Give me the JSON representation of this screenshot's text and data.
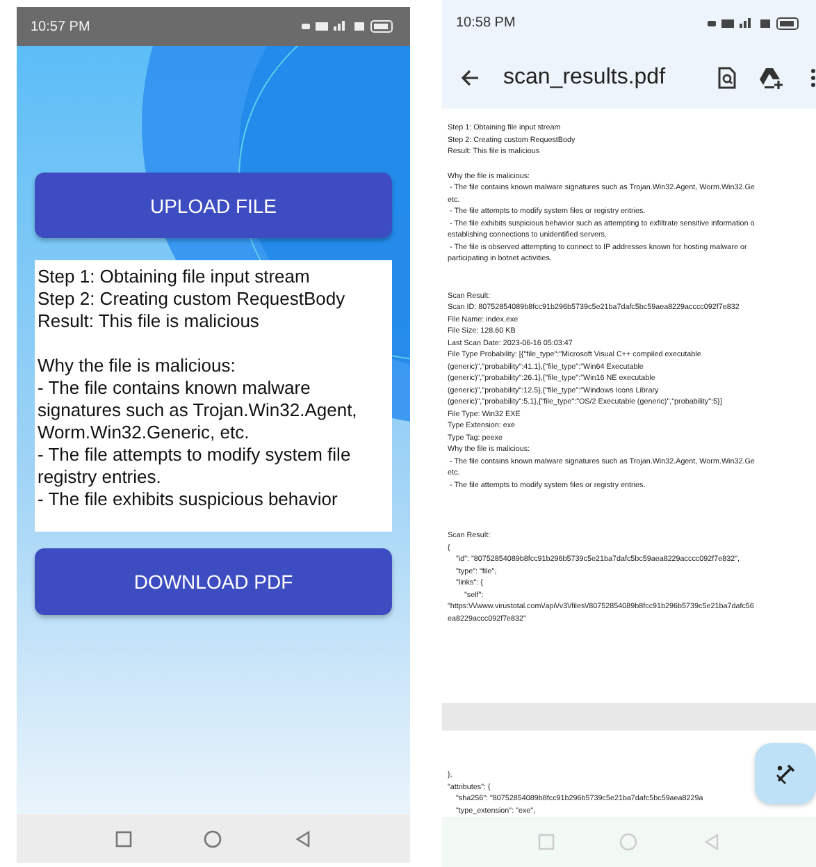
{
  "left_phone": {
    "status_bar": {
      "time": "10:57 PM"
    },
    "upload_button": "UPLOAD FILE",
    "result_blocks": [
      [
        "Step 1: Obtaining file input stream",
        "Step 2: Creating custom RequestBody",
        "Result: This file is malicious"
      ],
      [
        "Why the file is malicious:",
        " - The file contains known malware",
        "signatures such as Trojan.Win32.Agent,",
        "Worm.Win32.Generic, etc.",
        " - The file attempts to modify system file",
        "registry entries.",
        " - The file exhibits suspicious behavior"
      ]
    ],
    "download_button": "DOWNLOAD PDF"
  },
  "right_phone": {
    "status_bar": {
      "time": "10:58 PM"
    },
    "toolbar": {
      "title": "scan_results.pdf"
    },
    "page_1_blocks": [
      [
        "Step 1: Obtaining file input stream",
        "Step 2: Creating custom RequestBody",
        "Result: This file is malicious"
      ],
      [
        "Why the file is malicious:",
        " - The file contains known malware signatures such as Trojan.Win32.Agent, Worm.Win32.Ge",
        "etc.",
        " - The file attempts to modify system files or registry entries.",
        " - The file exhibits suspicious behavior such as attempting to exfiltrate sensitive information o",
        "establishing connections to unidentified servers.",
        " - The file is observed attempting to connect to IP addresses known for hosting malware or",
        "participating in botnet activities."
      ],
      [
        "Scan Result:",
        "Scan ID: 80752854089b8fcc91b296b5739c5e21ba7dafc5bc59aea8229acccc092f7e832",
        "File Name: index.exe",
        "File Size: 128.60 KB",
        "Last Scan Date: 2023-06-16 05:03:47",
        "File Type Probability: [{\"file_type\":\"Microsoft Visual C++ compiled executable",
        "(generic)\",\"probability\":41.1},{\"file_type\":\"Win64 Executable",
        "(generic)\",\"probability\":26.1},{\"file_type\":\"Win16 NE executable",
        "(generic)\",\"probability\":12.5},{\"file_type\":\"Windows Icons Library",
        "(generic)\",\"probability\":5.1},{\"file_type\":\"OS/2 Executable (generic)\",\"probability\":5}]",
        "File Type: Win32 EXE",
        "Type Extension: exe",
        "Type Tag: peexe",
        "Why the file is malicious:",
        " - The file contains known malware signatures such as Trojan.Win32.Agent, Worm.Win32.Ge",
        "etc.",
        " - The file attempts to modify system files or registry entries."
      ],
      [
        "Scan Result:",
        "{",
        "    \"id\": \"80752854089b8fcc91b296b5739c5e21ba7dafc5bc59aea8229acccc092f7e832\",",
        "    \"type\": \"file\",",
        "    \"links\": {",
        "        \"self\":",
        "\"https:\\/\\/www.virustotal.com\\/api\\/v3\\/files\\/80752854089b8fcc91b296b5739c5e21ba7dafc56",
        "ea8229accc092f7e832\""
      ]
    ],
    "page_2_lines": [
      "},",
      "\"attributes\": {",
      "    \"sha256\": \"80752854089b8fcc91b296b5739c5e21ba7dafc5bc59aea8229a",
      "    \"type_extension\": \"exe\","
    ]
  }
}
